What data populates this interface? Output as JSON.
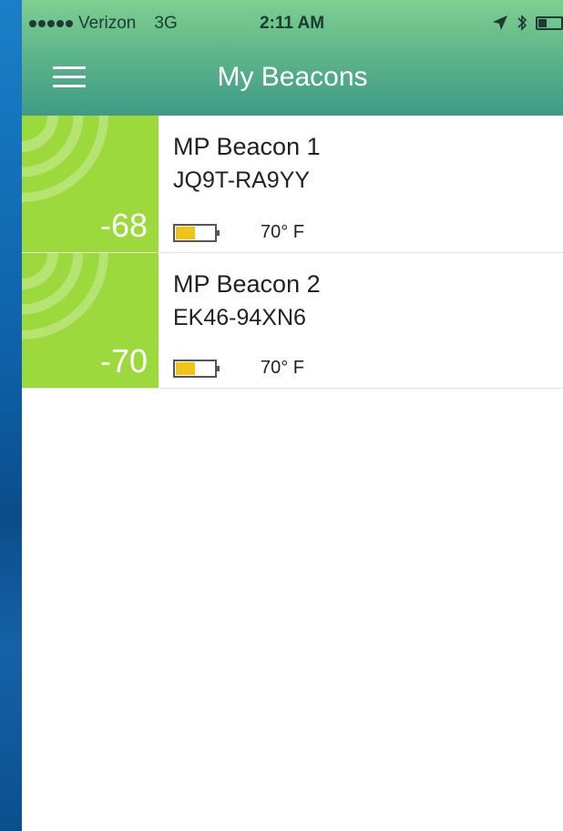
{
  "status_bar": {
    "carrier": "Verizon",
    "network": "3G",
    "time": "2:11 AM",
    "icons": [
      "signal-dots",
      "location-arrow-icon",
      "bluetooth-icon",
      "battery-icon"
    ]
  },
  "nav": {
    "title": "My Beacons",
    "menu_icon": "hamburger-menu-icon"
  },
  "beacons": [
    {
      "name": "MP Beacon 1",
      "serial": "JQ9T-RA9YY",
      "rssi": "-68",
      "temperature": "70° F",
      "battery_level": 0.5
    },
    {
      "name": "MP Beacon 2",
      "serial": "EK46-94XN6",
      "rssi": "-70",
      "temperature": "70° F",
      "battery_level": 0.5
    }
  ],
  "colors": {
    "header_top": "#7fcf8f",
    "header_bottom": "#3f9a86",
    "rssi_green": "#9cd93c",
    "battery_fill": "#f2c319",
    "battery_outline": "#555555",
    "backdrop_blue": "#0b5ea6"
  }
}
